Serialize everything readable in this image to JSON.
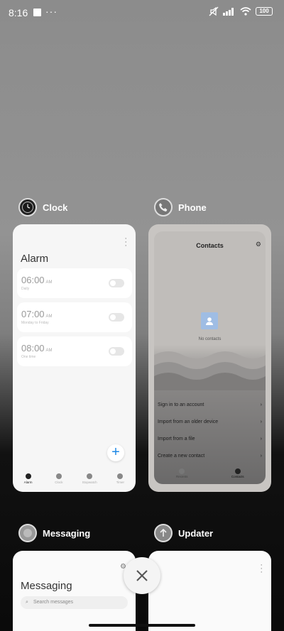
{
  "status_bar": {
    "time": "8:16",
    "dots": "···",
    "battery": "100"
  },
  "apps": {
    "clock": {
      "name": "Clock",
      "title": "Alarm",
      "alarms": [
        {
          "time": "06:00",
          "ampm": "AM",
          "sub": "Daily"
        },
        {
          "time": "07:00",
          "ampm": "AM",
          "sub": "Monday to Friday"
        },
        {
          "time": "08:00",
          "ampm": "AM",
          "sub": "One time"
        }
      ],
      "fab": "+",
      "nav": [
        "Alarm",
        "Clock",
        "Stopwatch",
        "Timer"
      ]
    },
    "phone": {
      "name": "Phone",
      "title": "Contacts",
      "empty_text": "No contacts",
      "actions": [
        "Sign in to an account",
        "Import from an older device",
        "Import from a file",
        "Create a new contact"
      ],
      "nav": [
        "Recents",
        "Contacts"
      ]
    },
    "messaging": {
      "name": "Messaging",
      "title": "Messaging",
      "search_placeholder": "Search messages"
    },
    "updater": {
      "name": "Updater"
    }
  },
  "colors": {
    "fab_accent": "#1e88e5",
    "contact_placeholder": "#9fbde4"
  }
}
